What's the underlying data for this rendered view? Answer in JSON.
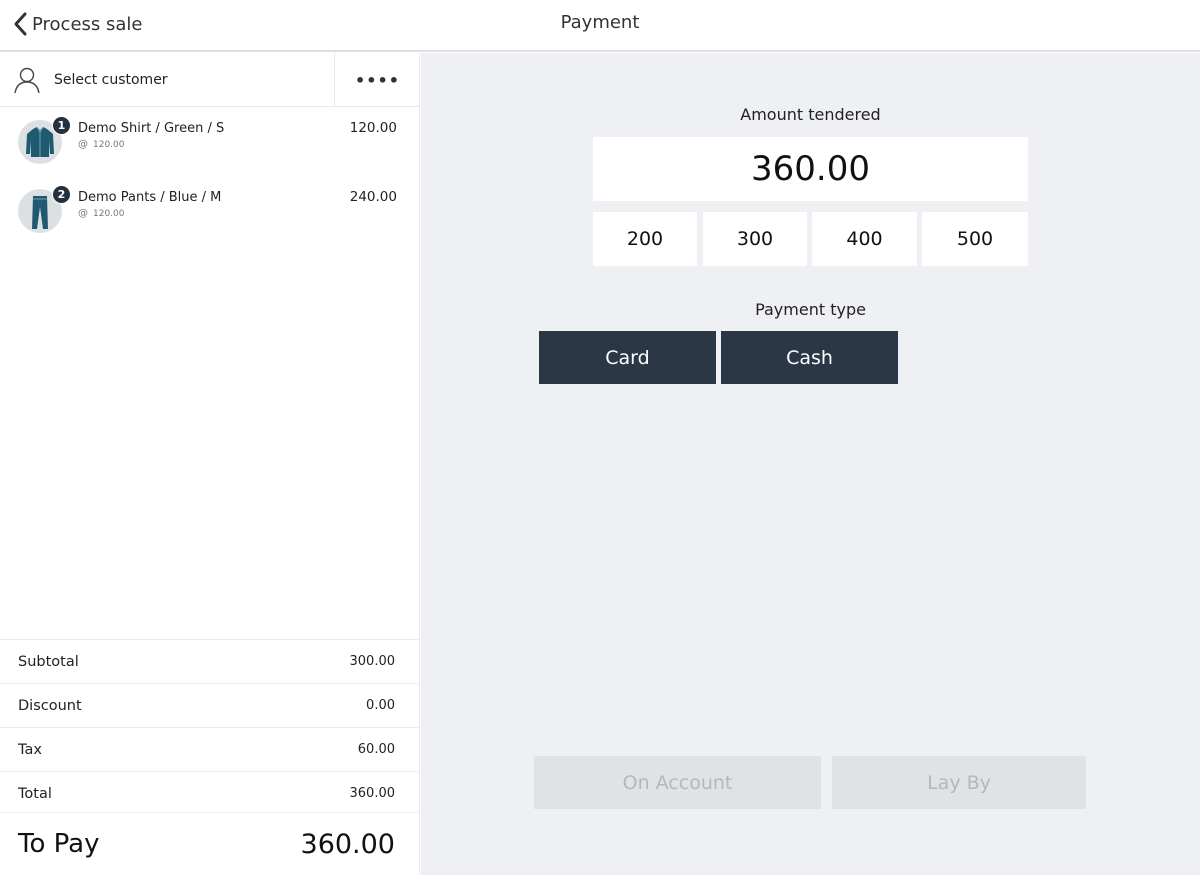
{
  "header": {
    "back_label": "Process sale",
    "title": "Payment"
  },
  "customer": {
    "select_label": "Select customer",
    "more_label": "••••"
  },
  "cart": {
    "items": [
      {
        "quantity": "1",
        "name": "Demo Shirt / Green / S",
        "unit_prefix": "@",
        "unit_price": "120.00",
        "line_total": "120.00",
        "icon": "shirt-icon"
      },
      {
        "quantity": "2",
        "name": "Demo Pants / Blue / M",
        "unit_prefix": "@",
        "unit_price": "120.00",
        "line_total": "240.00",
        "icon": "pants-icon"
      }
    ]
  },
  "summary": {
    "subtotal_label": "Subtotal",
    "subtotal": "300.00",
    "discount_label": "Discount",
    "discount": "0.00",
    "tax_label": "Tax",
    "tax": "60.00",
    "total_label": "Total",
    "total": "360.00",
    "to_pay_label": "To Pay",
    "to_pay": "360.00"
  },
  "payment": {
    "amount_label": "Amount tendered",
    "amount_value": "360.00",
    "quick_amounts": [
      "200",
      "300",
      "400",
      "500"
    ],
    "type_label": "Payment type",
    "types": [
      "Card",
      "Cash"
    ],
    "on_account_label": "On Account",
    "lay_by_label": "Lay By"
  },
  "colors": {
    "primary_button": "#2b3746",
    "panel_bg": "#eef0f4",
    "disabled_button": "#e0e2e3",
    "product_icon": "#1f5a70"
  }
}
